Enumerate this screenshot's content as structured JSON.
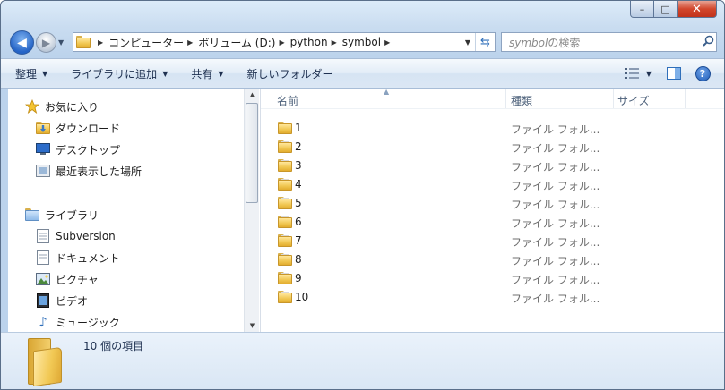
{
  "window": {
    "caption_buttons": {
      "minimize": "–",
      "maximize": "□",
      "close": "✕"
    }
  },
  "address_bar": {
    "breadcrumbs": [
      "コンピューター",
      "ボリューム (D:)",
      "python",
      "symbol"
    ],
    "search_placeholder_term": "symbol",
    "search_placeholder_suffix": "の検索"
  },
  "toolbar": {
    "organize": "整理",
    "add_to_library": "ライブラリに追加",
    "share": "共有",
    "new_folder": "新しいフォルダー"
  },
  "nav_pane": {
    "favorites": {
      "label": "お気に入り",
      "items": [
        {
          "label": "ダウンロード",
          "icon": "download-folder-icon"
        },
        {
          "label": "デスクトップ",
          "icon": "desktop-icon"
        },
        {
          "label": "最近表示した場所",
          "icon": "recent-places-icon"
        }
      ]
    },
    "libraries": {
      "label": "ライブラリ",
      "items": [
        {
          "label": "Subversion",
          "icon": "document-library-icon"
        },
        {
          "label": "ドキュメント",
          "icon": "documents-icon"
        },
        {
          "label": "ピクチャ",
          "icon": "pictures-icon"
        },
        {
          "label": "ビデオ",
          "icon": "videos-icon"
        },
        {
          "label": "ミュージック",
          "icon": "music-icon"
        }
      ]
    }
  },
  "content": {
    "columns": {
      "name": "名前",
      "type": "種類",
      "size": "サイズ"
    },
    "rows": [
      {
        "name": "1",
        "type": "ファイル フォル..."
      },
      {
        "name": "2",
        "type": "ファイル フォル..."
      },
      {
        "name": "3",
        "type": "ファイル フォル..."
      },
      {
        "name": "4",
        "type": "ファイル フォル..."
      },
      {
        "name": "5",
        "type": "ファイル フォル..."
      },
      {
        "name": "6",
        "type": "ファイル フォル..."
      },
      {
        "name": "7",
        "type": "ファイル フォル..."
      },
      {
        "name": "8",
        "type": "ファイル フォル..."
      },
      {
        "name": "9",
        "type": "ファイル フォル..."
      },
      {
        "name": "10",
        "type": "ファイル フォル..."
      }
    ]
  },
  "details": {
    "item_count_text": "10 個の項目"
  },
  "colors": {
    "accent": "#2463c6",
    "folder": "#f0c650",
    "chrome": "#c9dcf0"
  }
}
